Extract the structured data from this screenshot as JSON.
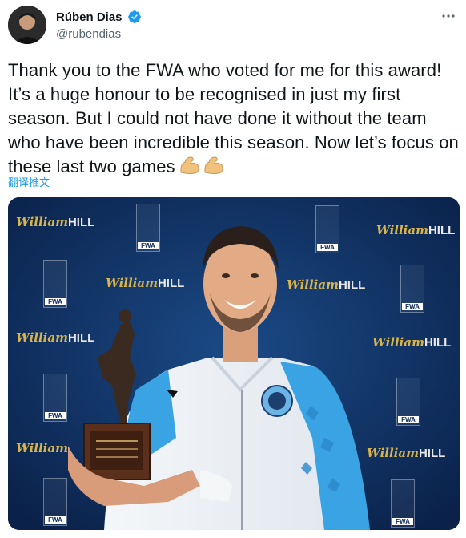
{
  "user": {
    "display_name": "Rúben Dias",
    "handle": "@rubendias",
    "verified": true
  },
  "tweet": {
    "text": "Thank you to the FWA who voted for me for this award! It’s a huge honour to be recognised in just my first season. But I could not have done it without the team who have been incredible this season. Now let’s focus on these last two games",
    "emoji": "flexed-biceps x2",
    "translate_label": "翻译推文"
  },
  "media": {
    "sponsor_logo_text": "William",
    "sponsor_logo_suffix": "HILL",
    "award_badge_text": "FWA"
  },
  "colors": {
    "accent": "#1d9bf0",
    "backdrop": "#0d2a57",
    "sponsor_gold": "#d8b44a"
  }
}
